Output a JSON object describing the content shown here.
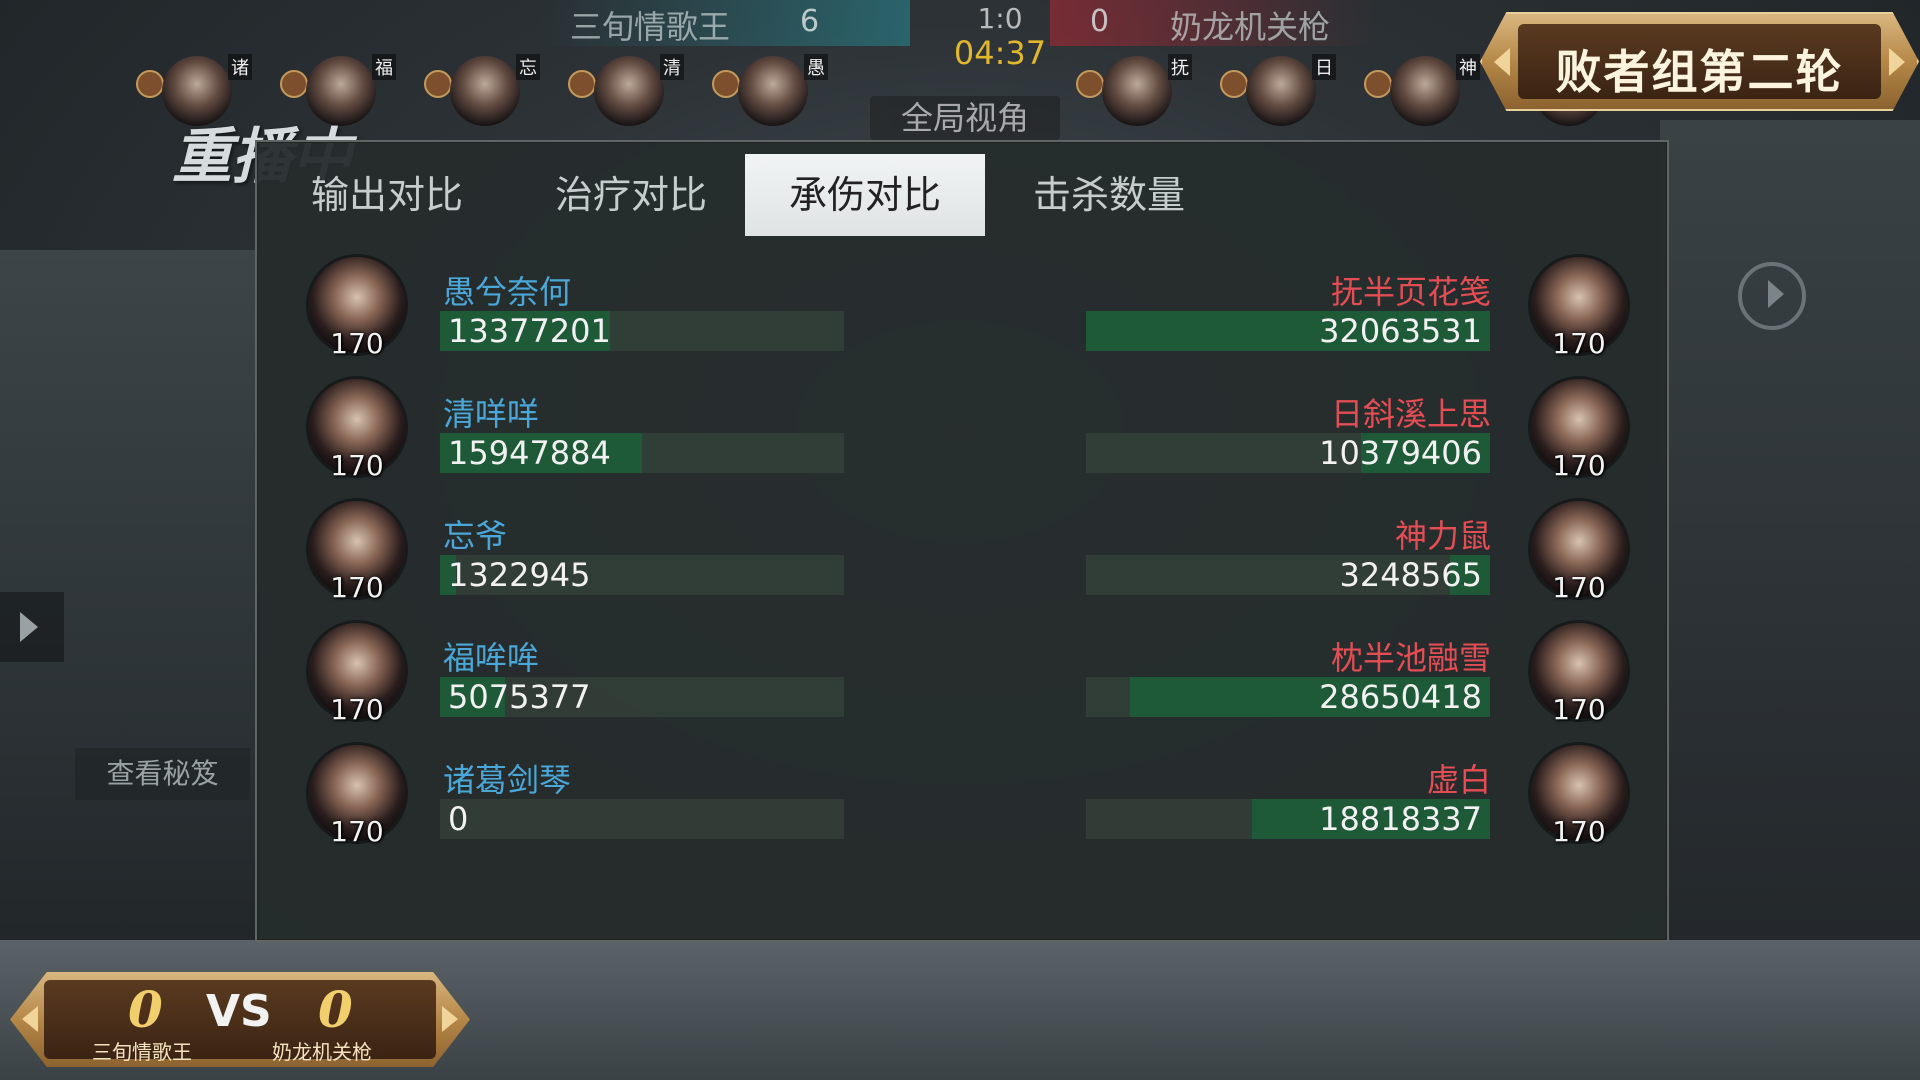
{
  "top": {
    "team_left": "三旬情歌王",
    "team_right": "奶龙机关枪",
    "kills_left": "6",
    "kills_right": "0",
    "match_score": "1:0",
    "timer": "04:37",
    "global_view": "全局视角"
  },
  "mini_heroes_left": [
    {
      "tag": "诸"
    },
    {
      "tag": "福"
    },
    {
      "tag": "忘"
    },
    {
      "tag": "清"
    },
    {
      "tag": "愚"
    }
  ],
  "mini_heroes_right": [
    {
      "tag": "抚"
    },
    {
      "tag": "日"
    },
    {
      "tag": "神"
    },
    {
      "tag": ""
    }
  ],
  "stage_title": "败者组第二轮",
  "replay_label": "重播中",
  "view_tips_label": "查看秘笈",
  "tabs": [
    "输出对比",
    "治疗对比",
    "承伤对比",
    "击杀数量"
  ],
  "active_tab": 2,
  "rows": [
    {
      "left": {
        "name": "愚兮奈何",
        "level": "170",
        "value": "13377201",
        "fill": 0.42
      },
      "right": {
        "name": "抚半页花笺",
        "level": "170",
        "value": "32063531",
        "fill": 1.0
      }
    },
    {
      "left": {
        "name": "清咩咩",
        "level": "170",
        "value": "15947884",
        "fill": 0.5
      },
      "right": {
        "name": "日斜溪上思",
        "level": "170",
        "value": "10379406",
        "fill": 0.32
      }
    },
    {
      "left": {
        "name": "忘爷",
        "level": "170",
        "value": "1322945",
        "fill": 0.04
      },
      "right": {
        "name": "神力鼠",
        "level": "170",
        "value": "3248565",
        "fill": 0.1
      }
    },
    {
      "left": {
        "name": "福哞哞",
        "level": "170",
        "value": "5075377",
        "fill": 0.16
      },
      "right": {
        "name": "枕半池融雪",
        "level": "170",
        "value": "28650418",
        "fill": 0.89
      }
    },
    {
      "left": {
        "name": "诸葛剑琴",
        "level": "170",
        "value": "0",
        "fill": 0.0
      },
      "right": {
        "name": "虚白",
        "level": "170",
        "value": "18818337",
        "fill": 0.59
      }
    }
  ],
  "series": {
    "score_left": "0",
    "score_right": "0",
    "vs": "VS",
    "team_left": "三旬情歌王",
    "team_right": "奶龙机关枪"
  },
  "colors": {
    "left_team": "#4aa7d8",
    "right_team": "#e54d55",
    "bar_fill": "#1e5a37",
    "timer": "#e0b72d"
  }
}
